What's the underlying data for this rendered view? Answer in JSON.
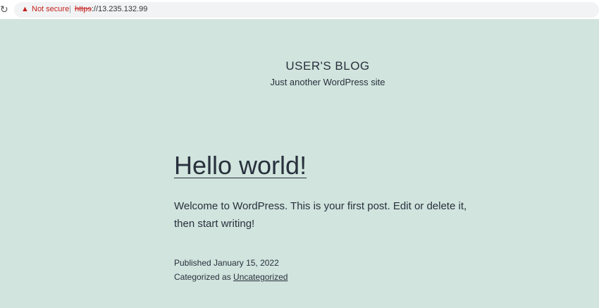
{
  "browser": {
    "security_label": "Not secure",
    "url_scheme": "https",
    "url_rest": "://13.235.132.99"
  },
  "site": {
    "title": "USER'S BLOG",
    "tagline": "Just another WordPress site"
  },
  "post": {
    "title": "Hello world!",
    "content": "Welcome to WordPress. This is your first post. Edit or delete it, then start writing!",
    "published": "Published January 15, 2022",
    "categorized_prefix": "Categorized as ",
    "category": "Uncategorized"
  }
}
